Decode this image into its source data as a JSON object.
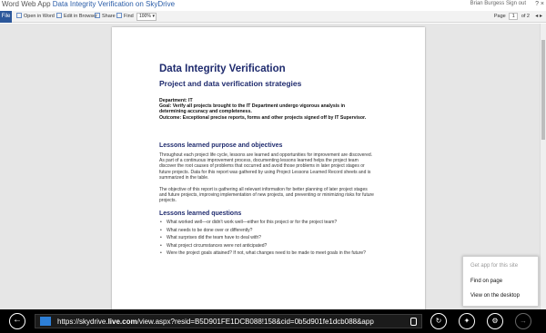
{
  "window": {
    "title_prefix": "Word Web App",
    "title_doc": "Data Integrity Verification on SkyDrive",
    "user": "Brian Burgess  Sign out",
    "controls": "?  ×"
  },
  "toolbar": {
    "file_label": "File",
    "open_in_word": "Open in Word",
    "edit_in_browser": "Edit in Browser",
    "share": "Share",
    "find": "Find",
    "zoom": "100%",
    "page_label": "Page",
    "page_current": "1",
    "page_total": "of 2"
  },
  "document": {
    "title": "Data Integrity Verification",
    "subtitle": "Project and data verification strategies",
    "department_label": "Department:",
    "department_value": "IT",
    "goal_label": "Goal:",
    "goal_value": "Verify all projects brought to the IT Department undergo vigorous analysis in determining accuracy and completeness.",
    "outcome_label": "Outcome:",
    "outcome_value": "Exceptional precise reports, forms and other projects signed off by IT Supervisor.",
    "section1_heading": "Lessons learned purpose and objectives",
    "section1_p1": "Throughout each project life cycle, lessons are learned and opportunities for improvement are discovered. As part of a continuous improvement process, documenting lessons learned helps the project team discover the root causes of problems that occurred and avoid those problems in later project stages or future projects. Data for this report was gathered by using Project Lessons Learned Record sheets and is summarized in the table.",
    "section1_p2": "The objective of this report is gathering all relevant information for better planning of later project stages and future projects, improving implementation of new projects, and preventing or minimizing risks for future projects.",
    "section2_heading": "Lessons learned questions",
    "questions": [
      "What worked well—or didn't work well—either for this project or for the project team?",
      "What needs to be done over or differently?",
      "What surprises did the team have to deal with?",
      "What project circumstances were not anticipated?",
      "Were the project goals attained? If not, what changes need to be made to meet goals in the future?"
    ]
  },
  "popup": {
    "get_app": "Get app for this site",
    "find_on_page": "Find on page",
    "view_desktop": "View on the desktop"
  },
  "appbar": {
    "url_prefix": "https://skydrive.",
    "url_domain": "live.com",
    "url_rest": "/view.aspx?resid=B5D901FE1DCB088!158&cid=0b5d901fe1dcb088&app"
  }
}
